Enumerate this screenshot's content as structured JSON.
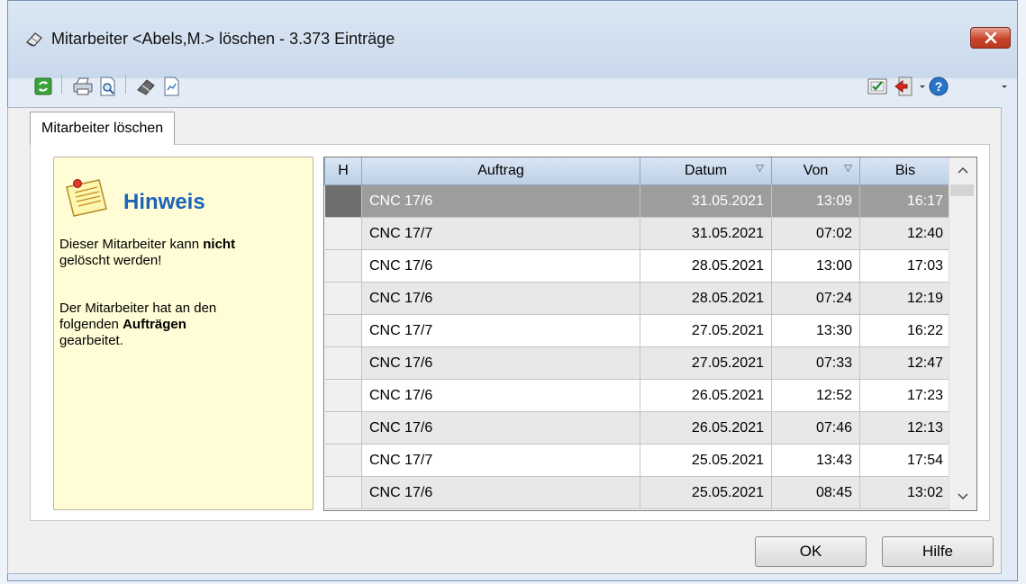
{
  "window": {
    "title": "Mitarbeiter <Abels,M.> löschen - 3.373 Einträge"
  },
  "tab": {
    "label": "Mitarbeiter löschen"
  },
  "hint": {
    "title": "Hinweis",
    "line1_pre": "Dieser Mitarbeiter kann ",
    "line1_bold": "nicht",
    "line2": "gelöscht werden!",
    "line3": "Der Mitarbeiter hat an den",
    "line4_pre": "folgenden ",
    "line4_bold": "Aufträgen",
    "line5": "gearbeitet."
  },
  "table": {
    "columns": {
      "h": "H",
      "auftrag": "Auftrag",
      "datum": "Datum",
      "von": "Von",
      "bis": "Bis"
    },
    "rows": [
      {
        "auftrag": "CNC 17/6",
        "datum": "31.05.2021",
        "von": "13:09",
        "bis": "16:17"
      },
      {
        "auftrag": "CNC 17/7",
        "datum": "31.05.2021",
        "von": "07:02",
        "bis": "12:40"
      },
      {
        "auftrag": "CNC 17/6",
        "datum": "28.05.2021",
        "von": "13:00",
        "bis": "17:03"
      },
      {
        "auftrag": "CNC 17/6",
        "datum": "28.05.2021",
        "von": "07:24",
        "bis": "12:19"
      },
      {
        "auftrag": "CNC 17/7",
        "datum": "27.05.2021",
        "von": "13:30",
        "bis": "16:22"
      },
      {
        "auftrag": "CNC 17/6",
        "datum": "27.05.2021",
        "von": "07:33",
        "bis": "12:47"
      },
      {
        "auftrag": "CNC 17/6",
        "datum": "26.05.2021",
        "von": "12:52",
        "bis": "17:23"
      },
      {
        "auftrag": "CNC 17/6",
        "datum": "26.05.2021",
        "von": "07:46",
        "bis": "12:13"
      },
      {
        "auftrag": "CNC 17/7",
        "datum": "25.05.2021",
        "von": "13:43",
        "bis": "17:54"
      },
      {
        "auftrag": "CNC 17/6",
        "datum": "25.05.2021",
        "von": "08:45",
        "bis": "13:02"
      }
    ]
  },
  "buttons": {
    "ok": "OK",
    "help": "Hilfe"
  },
  "icons": {
    "title": "eraser-icon",
    "toolbar": [
      "refresh-icon",
      "print-icon",
      "print-preview-icon",
      "eraser-icon",
      "chart-icon",
      "checklist-icon",
      "exit-icon",
      "help-icon"
    ]
  },
  "colors": {
    "hint_title": "#1c64b8",
    "hint_bg": "#fffcd6",
    "selected_row": "#9d9d9d",
    "close_button": "#c8452a"
  }
}
